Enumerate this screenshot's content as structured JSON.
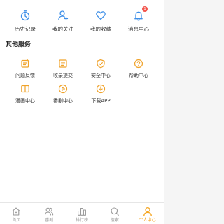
{
  "colors": {
    "shortcut_icon": "#3d8fe8",
    "service_icon": "#f0a32b",
    "active_tab": "#f5a623",
    "inactive_tab": "#999999",
    "badge": "#f2544b"
  },
  "shortcuts": [
    {
      "label": "历史记录",
      "icon": "clock-icon"
    },
    {
      "label": "我的关注",
      "icon": "user-follow-icon"
    },
    {
      "label": "我的收藏",
      "icon": "heart-icon"
    },
    {
      "label": "消息中心",
      "icon": "bell-icon",
      "badge": "1"
    }
  ],
  "services": {
    "title": "其他服务",
    "items": [
      {
        "label": "问题反馈",
        "icon": "feedback-icon"
      },
      {
        "label": "收录提交",
        "icon": "submit-icon"
      },
      {
        "label": "安全中心",
        "icon": "shield-icon"
      },
      {
        "label": "帮助中心",
        "icon": "help-icon"
      },
      {
        "label": "漫画中心",
        "icon": "book-icon"
      },
      {
        "label": "番剧中心",
        "icon": "play-icon"
      },
      {
        "label": "下载APP",
        "icon": "download-icon"
      }
    ]
  },
  "tabs": [
    {
      "label": "首页",
      "icon": "home-icon",
      "active": false
    },
    {
      "label": "番剧",
      "icon": "users-icon",
      "active": false
    },
    {
      "label": "排行榜",
      "icon": "ranking-icon",
      "active": false
    },
    {
      "label": "搜索",
      "icon": "search-icon",
      "active": false
    },
    {
      "label": "个人中心",
      "icon": "person-icon",
      "active": true
    }
  ]
}
